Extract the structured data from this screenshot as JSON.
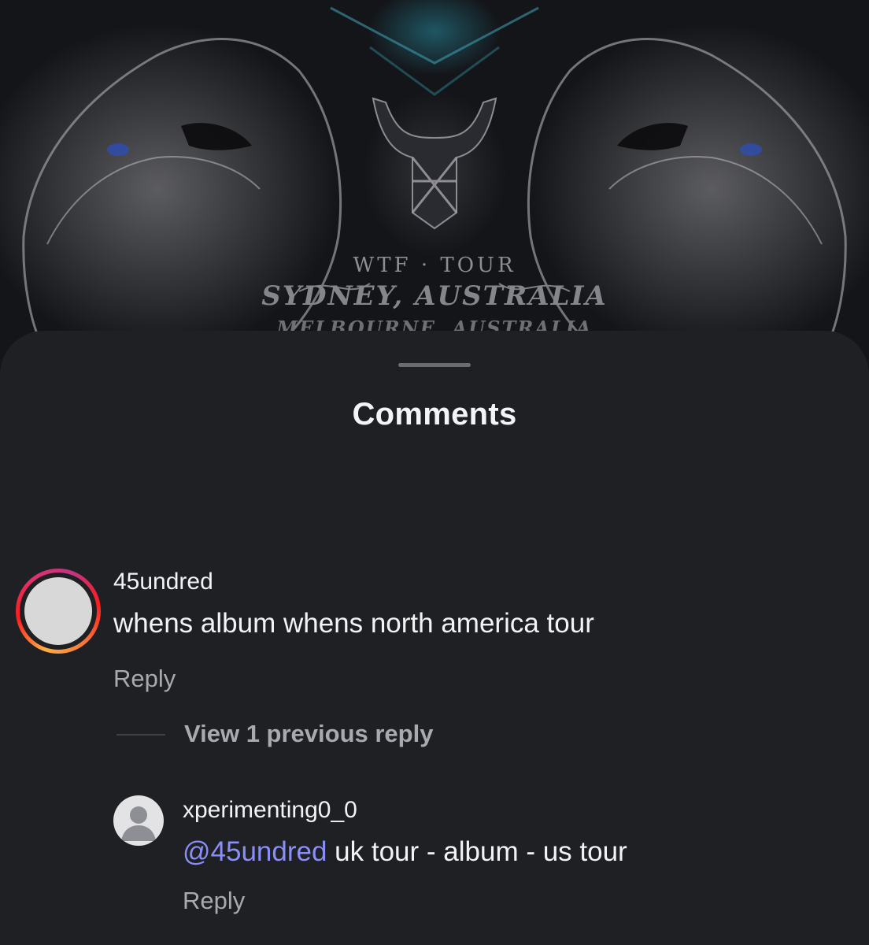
{
  "post": {
    "art_line1": "WTF  ·  TOUR",
    "art_line2": "SYDNEY, AUSTRALIA",
    "art_line3": "MELBOURNE, AUSTRALIA"
  },
  "sheet": {
    "title": "Comments"
  },
  "comment": {
    "username": "45undred",
    "text": "whens album whens north america tour",
    "reply_label": "Reply",
    "view_replies_label": "View 1 previous reply"
  },
  "reply": {
    "username": "xperimenting0_0",
    "mention": "@45undred",
    "text": " uk tour - album - us tour",
    "reply_label": "Reply"
  },
  "colors": {
    "sheet_background": "#1f2024",
    "mention": "#8a8ef8",
    "secondary_text": "#a8aab0",
    "primary_text": "#f2f3f5"
  }
}
